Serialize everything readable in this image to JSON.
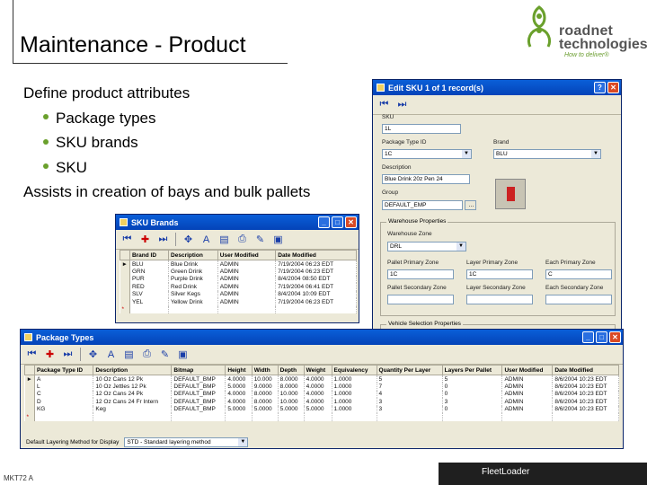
{
  "slide": {
    "title": "Maintenance - Product",
    "bullets": {
      "heading": "Define product attributes",
      "items": [
        "Package types",
        "SKU brands",
        "SKU"
      ],
      "closing": "Assists in creation of bays and bulk pallets"
    },
    "logo": {
      "line1": "roadnet",
      "line2": "technologies",
      "tagline": "How to deliver®"
    },
    "footer": {
      "code": "MKT72 A",
      "brand": "FleetLoader"
    },
    "colors": {
      "bullet": "#6aa02c",
      "window_title": "#0a5fd8",
      "footer": "#1f1f1f"
    }
  },
  "edit_sku": {
    "title": "Edit SKU 1 of 1 record(s)",
    "sku_label": "SKU",
    "sku_value": "1L",
    "package_label": "Package Type ID",
    "package_value": "1C",
    "brand_label": "Brand",
    "brand_value": "BLU",
    "desc_label": "Description",
    "desc_value": "Blue Drink 20z Pen 24",
    "group_label": "Group",
    "group_value": "DEFAULT_EMP",
    "warehouse_group": "Warehouse Properties",
    "zone_label": "Warehouse Zone",
    "zone_value": "DRL",
    "pallet_primary_label": "Pallet Primary Zone",
    "pallet_primary_value": "1C",
    "layer_primary_label": "Layer Primary Zone",
    "layer_primary_value": "1C",
    "each_primary_label": "Each Primary Zone",
    "each_primary_value": "C",
    "pallet_secondary_label": "Pallet Secondary Zone",
    "layer_secondary_label": "Layer Secondary Zone",
    "each_secondary_label": "Each Secondary Zone",
    "bottom_group": "Vehicle Selection Properties"
  },
  "sku_brands": {
    "title": "SKU Brands",
    "columns": [
      "Brand ID",
      "Description",
      "User Modified",
      "Date Modified"
    ],
    "rows": [
      [
        "BLU",
        "Blue Drink",
        "ADMIN",
        "7/19/2004 06:23 EDT"
      ],
      [
        "GRN",
        "Green Drink",
        "ADMIN",
        "7/19/2004 06:23 EDT"
      ],
      [
        "PUR",
        "Purple Drink",
        "ADMIN",
        "8/4/2004 08:50 EDT"
      ],
      [
        "RED",
        "Red Drink",
        "ADMIN",
        "7/19/2004 06:41 EDT"
      ],
      [
        "SLV",
        "Silver Kegs",
        "ADMIN",
        "8/4/2004 10:09 EDT"
      ],
      [
        "YEL",
        "Yellow Drink",
        "ADMIN",
        "7/19/2004 06:23 EDT"
      ]
    ],
    "new_row_marker": "*"
  },
  "package_types": {
    "title": "Package Types",
    "columns": [
      "Package Type ID",
      "Description",
      "Bitmap",
      "Height",
      "Width",
      "Depth",
      "Weight",
      "Equivalency",
      "Quantity Per Layer",
      "Layers Per Pallet",
      "User Modified",
      "Date Modified"
    ],
    "rows": [
      [
        "A",
        "10 Oz Cans 12 Pk",
        "DEFAULT_BMP",
        "4.0000",
        "10.000",
        "8.0000",
        "4.0000",
        "1.0000",
        "5",
        "5",
        "ADMIN",
        "8/6/2004 10:23 EDT"
      ],
      [
        "L",
        "10 Oz Jettles 12 Pk",
        "DEFAULT_BMP",
        "5.0000",
        "9.0000",
        "8.0000",
        "4.0000",
        "1.0000",
        "7",
        "0",
        "ADMIN",
        "8/6/2004 10:23 EDT"
      ],
      [
        "C",
        "12 Oz Cans 24 Pk",
        "DEFAULT_BMP",
        "4.0000",
        "8.0000",
        "10.000",
        "4.0000",
        "1.0000",
        "4",
        "0",
        "ADMIN",
        "8/6/2004 10:23 EDT"
      ],
      [
        "D",
        "12 Oz Cans 24 Fr Intern",
        "DEFAULT_BMP",
        "4.0000",
        "8.0000",
        "10.000",
        "4.0000",
        "1.0000",
        "3",
        "3",
        "ADMIN",
        "8/6/2004 10:23 EDT"
      ],
      [
        "KG",
        "Keg",
        "DEFAULT_BMP",
        "5.0000",
        "5.0000",
        "5.0000",
        "5.0000",
        "1.0000",
        "3",
        "0",
        "ADMIN",
        "8/6/2004 10:23 EDT"
      ]
    ],
    "new_row_marker": "*",
    "layering_label": "Default Layering Method for Display",
    "layering_value": "STD - Standard layering method"
  }
}
